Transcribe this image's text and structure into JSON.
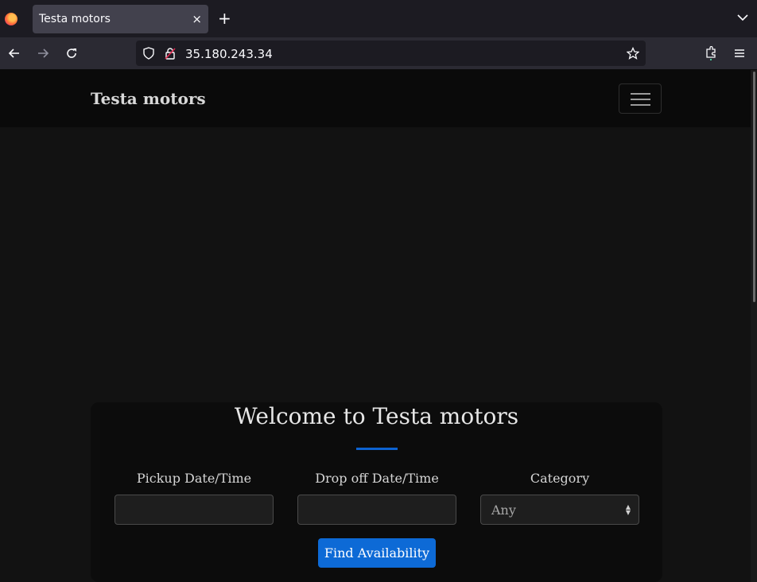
{
  "browser": {
    "tab_title": "Testa motors",
    "tab_close": "×",
    "new_tab": "+",
    "url": "35.180.243.34"
  },
  "site": {
    "brand": "Testa motors",
    "welcome": "Welcome to Testa motors",
    "pickup_label": "Pickup Date/Time",
    "pickup_value": "",
    "dropoff_label": "Drop off Date/Time",
    "dropoff_value": "",
    "category_label": "Category",
    "category_value": "Any",
    "find_button": "Find Availability"
  },
  "icons": [
    "firefox-logo-icon",
    "close-icon",
    "plus-icon",
    "chevron-down-icon",
    "back-arrow-icon",
    "forward-arrow-icon",
    "reload-icon",
    "shield-icon",
    "lock-icon",
    "star-icon",
    "extensions-icon",
    "menu-icon",
    "hamburger-icon"
  ],
  "colors": {
    "accent": "#0d6ad6",
    "page_bg": "#121212",
    "nav_bg": "#0a0a0a"
  }
}
